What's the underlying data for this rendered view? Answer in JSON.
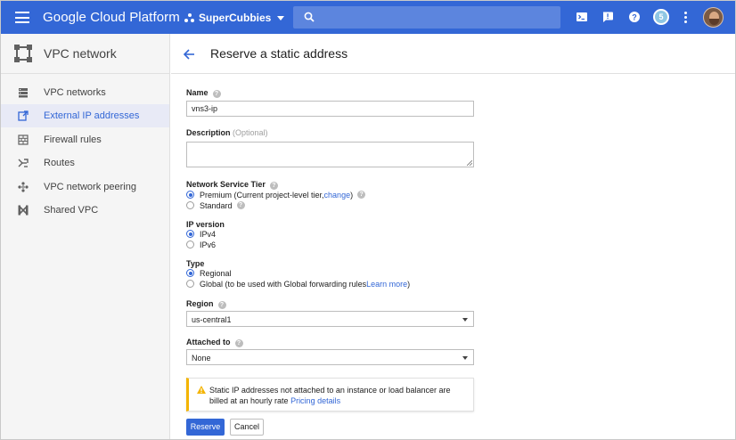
{
  "topbar": {
    "brand": "Google Cloud Platform",
    "project": "SuperCubbies",
    "notification_count": "5"
  },
  "sidebar": {
    "title": "VPC network",
    "items": [
      {
        "label": "VPC networks",
        "icon": "vpc-networks-icon"
      },
      {
        "label": "External IP addresses",
        "icon": "external-ip-icon"
      },
      {
        "label": "Firewall rules",
        "icon": "firewall-icon"
      },
      {
        "label": "Routes",
        "icon": "routes-icon"
      },
      {
        "label": "VPC network peering",
        "icon": "peering-icon"
      },
      {
        "label": "Shared VPC",
        "icon": "shared-vpc-icon"
      }
    ],
    "active_index": 1
  },
  "page": {
    "title": "Reserve a static address"
  },
  "form": {
    "name_label": "Name",
    "name_value": "vns3-ip",
    "description_label": "Description",
    "description_optional": "(Optional)",
    "description_value": "",
    "tier_label": "Network Service Tier",
    "tier_premium": "Premium (Current project-level tier, ",
    "tier_change_link": "change",
    "tier_premium_close": ")",
    "tier_standard": "Standard",
    "tier_selected": "Premium",
    "ipversion_label": "IP version",
    "ipv4": "IPv4",
    "ipv6": "IPv6",
    "ipversion_selected": "IPv4",
    "type_label": "Type",
    "type_regional": "Regional",
    "type_global": "Global (to be used with Global forwarding rules ",
    "type_learn_more": "Learn more",
    "type_global_close": ")",
    "type_selected": "Regional",
    "region_label": "Region",
    "region_value": "us-central1",
    "attached_label": "Attached to",
    "attached_value": "None",
    "warning_text": "Static IP addresses not attached to an instance or load balancer are billed at an hourly rate ",
    "warning_link": "Pricing details",
    "reserve_button": "Reserve",
    "cancel_button": "Cancel"
  },
  "colors": {
    "topbar": "#3367d6",
    "accent": "#3367d6",
    "warning": "#f4b400"
  }
}
